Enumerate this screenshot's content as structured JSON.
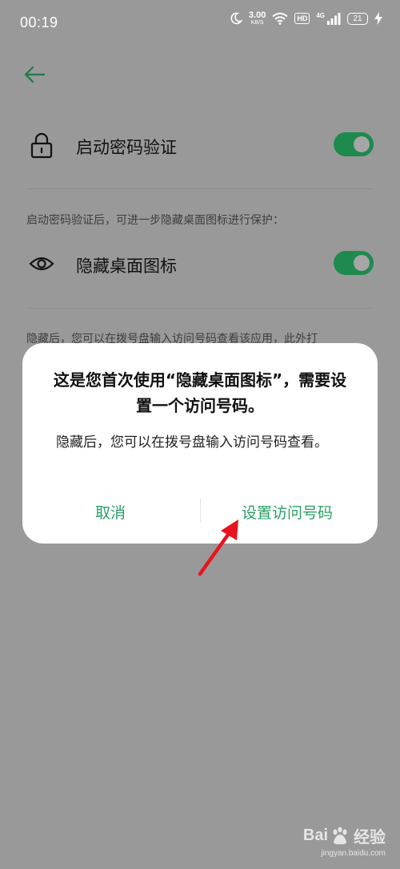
{
  "status_bar": {
    "time": "00:19",
    "speed_value": "3.00",
    "speed_unit": "KB/S",
    "hd_label": "HD",
    "network_label": "4G",
    "battery_level": "21"
  },
  "settings": {
    "password_row": {
      "label": "启动密码验证",
      "icon": "lock-icon",
      "enabled": true
    },
    "hint_text": "启动密码验证后，可进一步隐藏桌面图标进行保护：",
    "hide_icon_row": {
      "label": "隐藏桌面图标",
      "icon": "eye-icon",
      "enabled": true
    },
    "description_partial": "隐藏后，您可以在拨号盘输入访问号码查看该应用，此外打"
  },
  "dialog": {
    "title": "这是您首次使用“隐藏桌面图标”，需要设置一个访问号码。",
    "message": "隐藏后，您可以在拨号盘输入访问号码查看。",
    "cancel_label": "取消",
    "confirm_label": "设置访问号码"
  },
  "colors": {
    "accent_green": "#2aa065",
    "toggle_green": "#1e8a4e",
    "scrim": "#999999",
    "annotation_red": "#e8141e"
  },
  "watermark": {
    "brand": "Bai",
    "brand_suffix": "经验",
    "url": "jingyan.baidu.com"
  }
}
